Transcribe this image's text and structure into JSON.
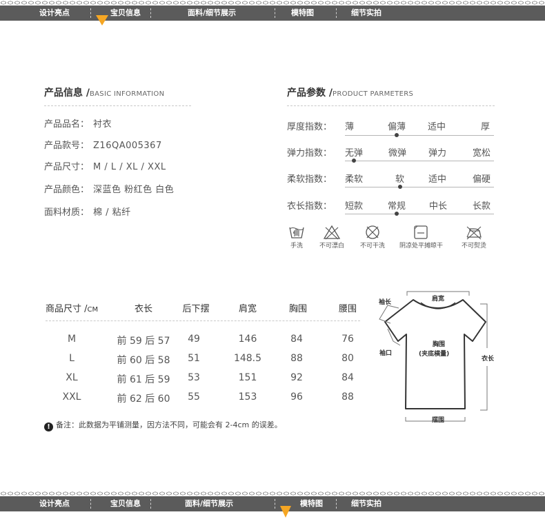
{
  "nav": {
    "items": [
      "设计亮点",
      "宝贝信息",
      "面料/细节展示",
      "模特图",
      "细节实拍"
    ]
  },
  "product_info": {
    "title": "产品信息 /",
    "title_en": "BASIC INFORMATION",
    "rows": [
      {
        "label": "产品品名：",
        "value": "衬衣"
      },
      {
        "label": "产品款号：",
        "value": "Z16QA005367"
      },
      {
        "label": "产品尺寸：",
        "value": "M / L / XL / XXL"
      },
      {
        "label": "产品颜色：",
        "value": "深蓝色 粉红色 白色"
      },
      {
        "label": "面料材质：",
        "value": "棉 / 粘纤"
      }
    ]
  },
  "product_params": {
    "title": "产品参数 /",
    "title_en": "PRODUCT PARMETERS",
    "rows": [
      {
        "label": "厚度指数：",
        "options": [
          "薄",
          "偏薄",
          "适中",
          "厚"
        ],
        "selected": 1
      },
      {
        "label": "弹力指数：",
        "options": [
          "无弹",
          "微弹",
          "弹力",
          "宽松"
        ],
        "selected": 0
      },
      {
        "label": "柔软指数：",
        "options": [
          "柔软",
          "软",
          "适中",
          "偏硬"
        ],
        "selected": 1
      },
      {
        "label": "衣长指数：",
        "options": [
          "短款",
          "常规",
          "中长",
          "长款"
        ],
        "selected": 1
      }
    ]
  },
  "care": {
    "items": [
      {
        "icon": "hand-wash-icon",
        "label": "手洗"
      },
      {
        "icon": "no-bleach-icon",
        "label": "不可漂白"
      },
      {
        "icon": "no-tumble-dry-icon",
        "label": "不可干洗"
      },
      {
        "icon": "shade-flat-dry-icon",
        "label": "阴凉处平摊晾干"
      },
      {
        "icon": "no-iron-icon",
        "label": "不可熨烫"
      }
    ]
  },
  "size_table": {
    "header_label": "商品尺寸 /",
    "header_unit": "CM",
    "columns": [
      "衣长",
      "后下摆",
      "肩宽",
      "胸围",
      "腰围"
    ],
    "rows": [
      {
        "size": "M",
        "values": [
          "前 59 后 57",
          "49",
          "146",
          "84",
          "76"
        ]
      },
      {
        "size": "L",
        "values": [
          "前 60 后 58",
          "51",
          "148.5",
          "88",
          "80"
        ]
      },
      {
        "size": "XL",
        "values": [
          "前 61 后 59",
          "53",
          "151",
          "92",
          "84"
        ]
      },
      {
        "size": "XXL",
        "values": [
          "前 62 后 60",
          "55",
          "153",
          "96",
          "88"
        ]
      }
    ],
    "note": "备注：此数据为平铺测量，因方法不同，可能会有 2-4cm 的误差。",
    "note_icon": "!"
  },
  "diagram": {
    "labels": {
      "sleeve_length": "袖长",
      "shoulder_width": "肩宽",
      "chest": "胸围",
      "chest_note": "(夹底横量)",
      "cuff": "袖口",
      "body_length": "衣长",
      "hem": "摆围"
    }
  }
}
